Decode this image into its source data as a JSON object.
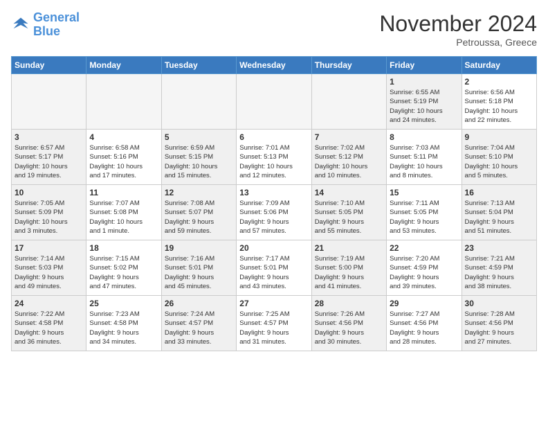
{
  "header": {
    "logo_line1": "General",
    "logo_line2": "Blue",
    "month_title": "November 2024",
    "location": "Petroussa, Greece"
  },
  "days_of_week": [
    "Sunday",
    "Monday",
    "Tuesday",
    "Wednesday",
    "Thursday",
    "Friday",
    "Saturday"
  ],
  "weeks": [
    [
      {
        "day": "",
        "info": "",
        "empty": true
      },
      {
        "day": "",
        "info": "",
        "empty": true
      },
      {
        "day": "",
        "info": "",
        "empty": true
      },
      {
        "day": "",
        "info": "",
        "empty": true
      },
      {
        "day": "",
        "info": "",
        "empty": true
      },
      {
        "day": "1",
        "info": "Sunrise: 6:55 AM\nSunset: 5:19 PM\nDaylight: 10 hours\nand 24 minutes.",
        "shaded": true
      },
      {
        "day": "2",
        "info": "Sunrise: 6:56 AM\nSunset: 5:18 PM\nDaylight: 10 hours\nand 22 minutes.",
        "shaded": false
      }
    ],
    [
      {
        "day": "3",
        "info": "Sunrise: 6:57 AM\nSunset: 5:17 PM\nDaylight: 10 hours\nand 19 minutes.",
        "shaded": true
      },
      {
        "day": "4",
        "info": "Sunrise: 6:58 AM\nSunset: 5:16 PM\nDaylight: 10 hours\nand 17 minutes.",
        "shaded": false
      },
      {
        "day": "5",
        "info": "Sunrise: 6:59 AM\nSunset: 5:15 PM\nDaylight: 10 hours\nand 15 minutes.",
        "shaded": true
      },
      {
        "day": "6",
        "info": "Sunrise: 7:01 AM\nSunset: 5:13 PM\nDaylight: 10 hours\nand 12 minutes.",
        "shaded": false
      },
      {
        "day": "7",
        "info": "Sunrise: 7:02 AM\nSunset: 5:12 PM\nDaylight: 10 hours\nand 10 minutes.",
        "shaded": true
      },
      {
        "day": "8",
        "info": "Sunrise: 7:03 AM\nSunset: 5:11 PM\nDaylight: 10 hours\nand 8 minutes.",
        "shaded": false
      },
      {
        "day": "9",
        "info": "Sunrise: 7:04 AM\nSunset: 5:10 PM\nDaylight: 10 hours\nand 5 minutes.",
        "shaded": true
      }
    ],
    [
      {
        "day": "10",
        "info": "Sunrise: 7:05 AM\nSunset: 5:09 PM\nDaylight: 10 hours\nand 3 minutes.",
        "shaded": true
      },
      {
        "day": "11",
        "info": "Sunrise: 7:07 AM\nSunset: 5:08 PM\nDaylight: 10 hours\nand 1 minute.",
        "shaded": false
      },
      {
        "day": "12",
        "info": "Sunrise: 7:08 AM\nSunset: 5:07 PM\nDaylight: 9 hours\nand 59 minutes.",
        "shaded": true
      },
      {
        "day": "13",
        "info": "Sunrise: 7:09 AM\nSunset: 5:06 PM\nDaylight: 9 hours\nand 57 minutes.",
        "shaded": false
      },
      {
        "day": "14",
        "info": "Sunrise: 7:10 AM\nSunset: 5:05 PM\nDaylight: 9 hours\nand 55 minutes.",
        "shaded": true
      },
      {
        "day": "15",
        "info": "Sunrise: 7:11 AM\nSunset: 5:05 PM\nDaylight: 9 hours\nand 53 minutes.",
        "shaded": false
      },
      {
        "day": "16",
        "info": "Sunrise: 7:13 AM\nSunset: 5:04 PM\nDaylight: 9 hours\nand 51 minutes.",
        "shaded": true
      }
    ],
    [
      {
        "day": "17",
        "info": "Sunrise: 7:14 AM\nSunset: 5:03 PM\nDaylight: 9 hours\nand 49 minutes.",
        "shaded": true
      },
      {
        "day": "18",
        "info": "Sunrise: 7:15 AM\nSunset: 5:02 PM\nDaylight: 9 hours\nand 47 minutes.",
        "shaded": false
      },
      {
        "day": "19",
        "info": "Sunrise: 7:16 AM\nSunset: 5:01 PM\nDaylight: 9 hours\nand 45 minutes.",
        "shaded": true
      },
      {
        "day": "20",
        "info": "Sunrise: 7:17 AM\nSunset: 5:01 PM\nDaylight: 9 hours\nand 43 minutes.",
        "shaded": false
      },
      {
        "day": "21",
        "info": "Sunrise: 7:19 AM\nSunset: 5:00 PM\nDaylight: 9 hours\nand 41 minutes.",
        "shaded": true
      },
      {
        "day": "22",
        "info": "Sunrise: 7:20 AM\nSunset: 4:59 PM\nDaylight: 9 hours\nand 39 minutes.",
        "shaded": false
      },
      {
        "day": "23",
        "info": "Sunrise: 7:21 AM\nSunset: 4:59 PM\nDaylight: 9 hours\nand 38 minutes.",
        "shaded": true
      }
    ],
    [
      {
        "day": "24",
        "info": "Sunrise: 7:22 AM\nSunset: 4:58 PM\nDaylight: 9 hours\nand 36 minutes.",
        "shaded": true
      },
      {
        "day": "25",
        "info": "Sunrise: 7:23 AM\nSunset: 4:58 PM\nDaylight: 9 hours\nand 34 minutes.",
        "shaded": false
      },
      {
        "day": "26",
        "info": "Sunrise: 7:24 AM\nSunset: 4:57 PM\nDaylight: 9 hours\nand 33 minutes.",
        "shaded": true
      },
      {
        "day": "27",
        "info": "Sunrise: 7:25 AM\nSunset: 4:57 PM\nDaylight: 9 hours\nand 31 minutes.",
        "shaded": false
      },
      {
        "day": "28",
        "info": "Sunrise: 7:26 AM\nSunset: 4:56 PM\nDaylight: 9 hours\nand 30 minutes.",
        "shaded": true
      },
      {
        "day": "29",
        "info": "Sunrise: 7:27 AM\nSunset: 4:56 PM\nDaylight: 9 hours\nand 28 minutes.",
        "shaded": false
      },
      {
        "day": "30",
        "info": "Sunrise: 7:28 AM\nSunset: 4:56 PM\nDaylight: 9 hours\nand 27 minutes.",
        "shaded": true
      }
    ]
  ]
}
